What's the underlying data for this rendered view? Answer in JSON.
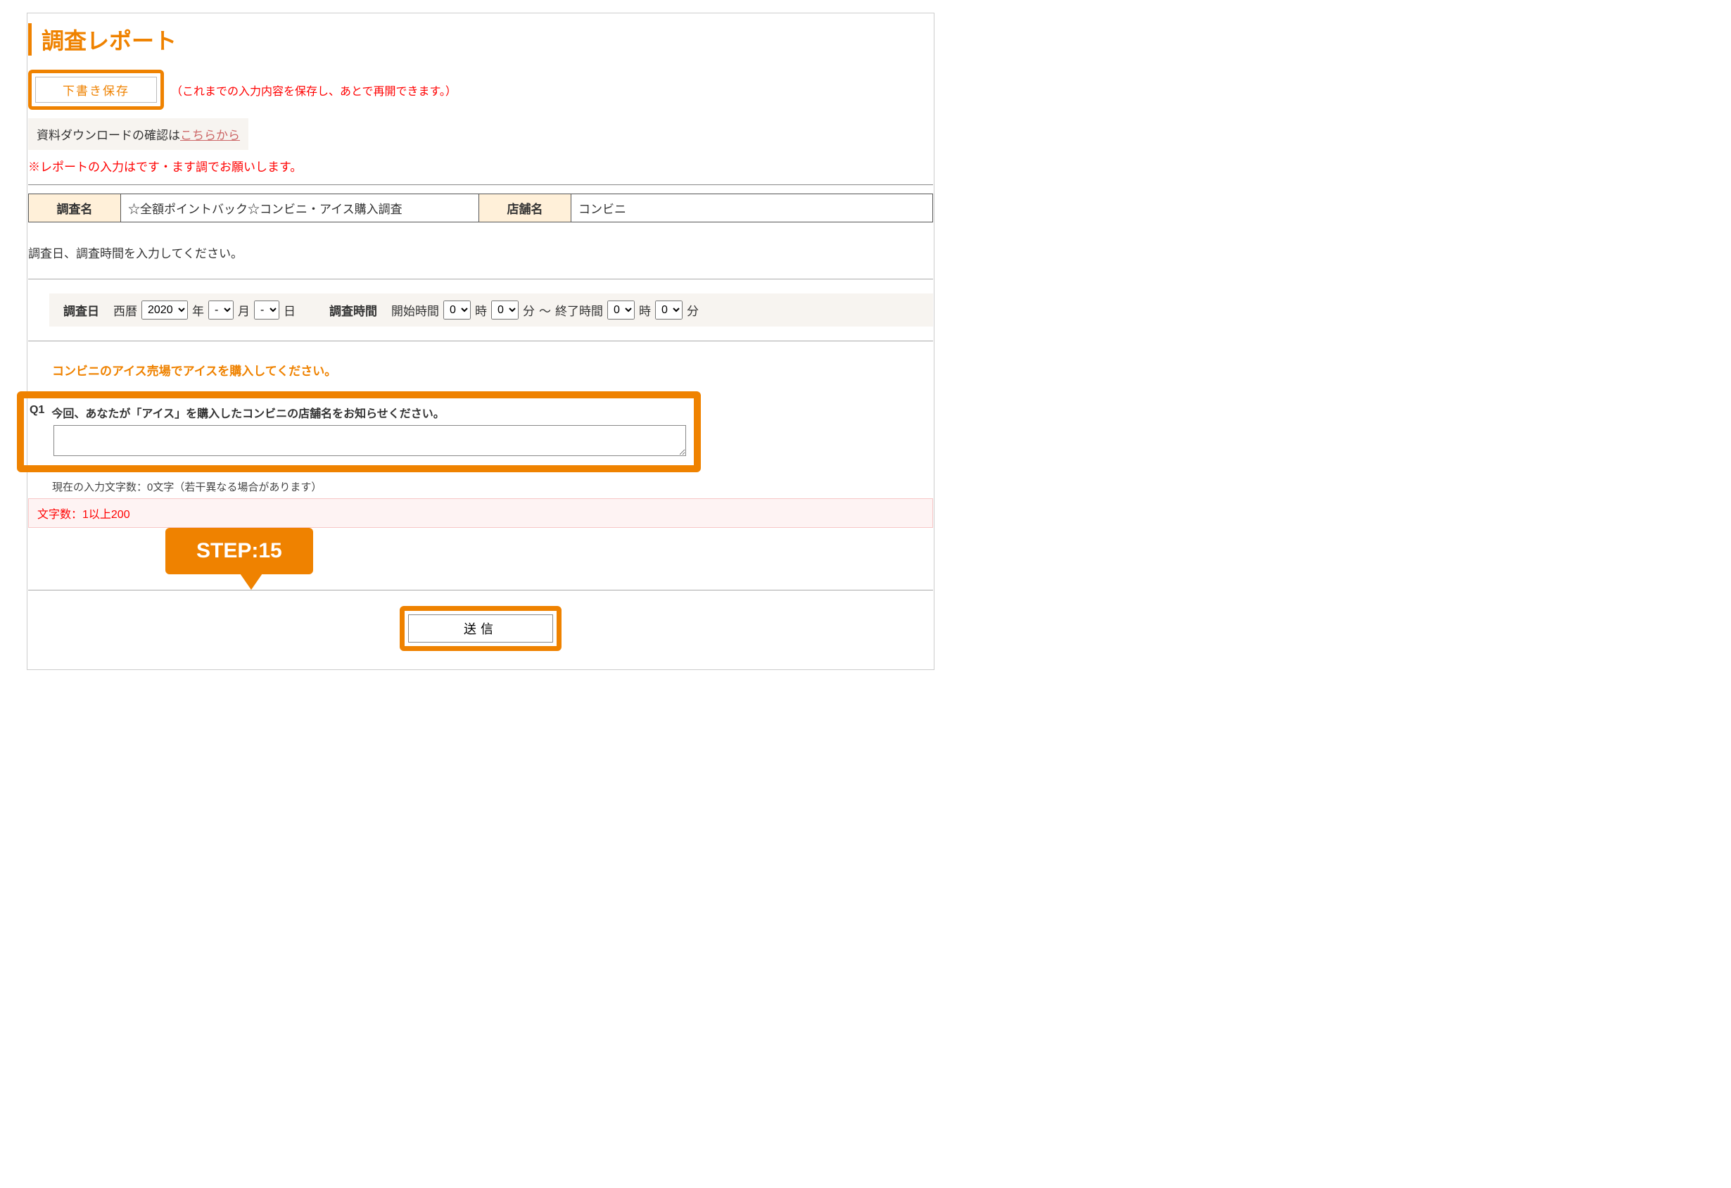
{
  "page_title": "調査レポート",
  "draft_button": "下書き保存",
  "save_note": "（これまでの入力内容を保存し、あとで再開できます。）",
  "download_prefix": "資料ダウンロードの確認は",
  "download_link": "こちらから",
  "report_warning": "※レポートの入力はです・ます調でお願いします。",
  "survey": {
    "name_label": "調査名",
    "name_value": "☆全額ポイントバック☆コンビニ・アイス購入調査",
    "store_label": "店舗名",
    "store_value": "コンビニ"
  },
  "datetime_instruction": "調査日、調査時間を入力してください。",
  "date": {
    "label": "調査日",
    "era": "西暦",
    "year": "2020",
    "year_suf": "年",
    "month": "-",
    "month_suf": "月",
    "day": "-",
    "day_suf": "日"
  },
  "time": {
    "label": "調査時間",
    "start_prefix": "開始時間",
    "h1": "0",
    "h_suf": "時",
    "m1": "0",
    "m_suf": "分",
    "sep": "～",
    "end_prefix": "終了時間",
    "h2": "0",
    "m2": "0"
  },
  "q_instruction": "コンビニのアイス売場でアイスを購入してください。",
  "q1_no": "Q1",
  "q1_text": "今回、あなたが「アイス」を購入したコンビニの店舗名をお知らせください。",
  "char_now": "現在の入力文字数：0文字（若干異なる場合があります）",
  "char_limit": "文字数：1以上200",
  "step_label": "STEP:15",
  "submit": "送信"
}
